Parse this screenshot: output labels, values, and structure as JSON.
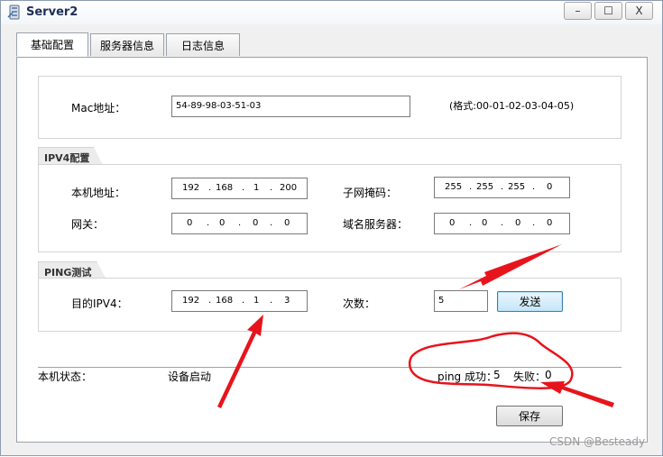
{
  "window": {
    "title": "Server2"
  },
  "titlebar_buttons": {
    "minimize": "–",
    "maximize": "☐",
    "close": "X"
  },
  "tabs": [
    {
      "label": "基础配置",
      "active": true
    },
    {
      "label": "服务器信息",
      "active": false
    },
    {
      "label": "日志信息",
      "active": false
    }
  ],
  "mac": {
    "label": "Mac地址：",
    "value": "54-89-98-03-51-03",
    "format_hint": "(格式:00-01-02-03-04-05)"
  },
  "ipv4": {
    "header": "IPV4配置",
    "local_ip": {
      "label": "本机地址：",
      "octets": [
        "192",
        "168",
        "1",
        "200"
      ]
    },
    "subnet_mask": {
      "label": "子网掩码：",
      "octets": [
        "255",
        "255",
        "255",
        "0"
      ]
    },
    "gateway": {
      "label": "网关：",
      "octets": [
        "0",
        "0",
        "0",
        "0"
      ]
    },
    "dns": {
      "label": "域名服务器：",
      "octets": [
        "0",
        "0",
        "0",
        "0"
      ]
    }
  },
  "ping": {
    "header": "PING测试",
    "target": {
      "label": "目的IPV4：",
      "octets": [
        "192",
        "168",
        "1",
        "3"
      ]
    },
    "count": {
      "label": "次数：",
      "value": "5"
    },
    "send_label": "发送"
  },
  "status": {
    "label": "本机状态：",
    "value": "设备启动",
    "ping_success_label": "ping 成功：",
    "ping_success_value": "5",
    "fail_label": "失败：",
    "fail_value": "0"
  },
  "save_label": "保存",
  "watermark": "CSDN @Besteady",
  "colors": {
    "annotation": "#e8141c",
    "focus_button": "#3c7fb1"
  }
}
